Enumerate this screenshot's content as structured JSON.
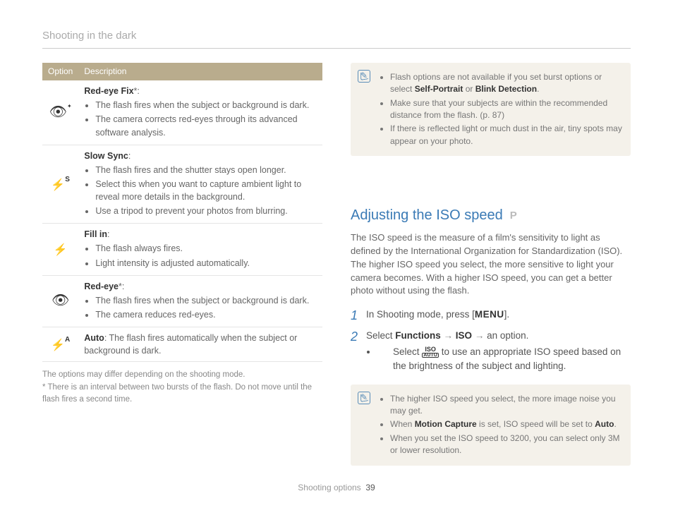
{
  "header": {
    "title": "Shooting in the dark"
  },
  "table": {
    "col_option": "Option",
    "col_description": "Description",
    "rows": [
      {
        "icon_name": "red-eye-fix-icon",
        "title": "Red-eye Fix",
        "title_suffix": "*",
        "title_after": ":",
        "bullets": [
          "The flash fires when the subject or background is dark.",
          "The camera corrects red-eyes through its advanced software analysis."
        ]
      },
      {
        "icon_name": "slow-sync-icon",
        "title": "Slow Sync",
        "title_after": ":",
        "bullets": [
          "The flash fires and the shutter stays open longer.",
          "Select this when you want to capture ambient light to reveal more details in the background.",
          "Use a tripod to prevent your photos from blurring."
        ]
      },
      {
        "icon_name": "fill-in-icon",
        "title": "Fill in",
        "title_after": ":",
        "bullets": [
          "The flash always fires.",
          "Light intensity is adjusted automatically."
        ]
      },
      {
        "icon_name": "red-eye-icon",
        "title": "Red-eye",
        "title_suffix": "*",
        "title_after": ":",
        "bullets": [
          "The flash fires when the subject or background is dark.",
          "The camera reduces red-eyes."
        ]
      },
      {
        "icon_name": "auto-flash-icon",
        "title": "Auto",
        "inline_text": ": The flash fires automatically when the subject or background is dark."
      }
    ]
  },
  "footnotes": {
    "line1": "The options may differ depending on the shooting mode.",
    "line2": "* There is an interval between two bursts of the flash. Do not move until the flash fires a second time."
  },
  "infobox1": {
    "b1_pre": "Flash options are not available if you set burst options or select ",
    "b1_strong1": "Self-Portrait",
    "b1_mid": " or ",
    "b1_strong2": "Blink Detection",
    "b1_post": ".",
    "b2": "Make sure that your subjects are within the recommended distance from the flash. (p. 87)",
    "b3": "If there is reflected light or much dust in the air, tiny spots may appear on your photo."
  },
  "section": {
    "heading": "Adjusting the ISO speed",
    "mode": "P",
    "intro": "The ISO speed is the measure of a film's sensitivity to light as defined by the International Organization for Standardization (ISO). The higher ISO speed you select, the more sensitive to light your camera becomes. With a higher ISO speed, you can get a better photo without using the flash.",
    "step1_pre": "In Shooting mode, press [",
    "step1_menu": "MENU",
    "step1_post": "].",
    "step2_pre": "Select ",
    "step2_functions": "Functions",
    "step2_arrow": " → ",
    "step2_iso": "ISO",
    "step2_post": " an option.",
    "step2_sub_pre": "Select ",
    "step2_sub_post": " to use an appropriate ISO speed based on the brightness of the subject and lighting.",
    "iso_icon_top": "ISO",
    "iso_icon_bottom": "AUTO"
  },
  "infobox2": {
    "b1": "The higher ISO speed you select, the more image noise you may get.",
    "b2_pre": "When ",
    "b2_strong": "Motion Capture",
    "b2_mid": " is set, ISO speed will be set to ",
    "b2_strong2": "Auto",
    "b2_post": ".",
    "b3": "When you set the ISO speed to 3200, you can select only 3M or lower resolution."
  },
  "footer": {
    "section": "Shooting options",
    "page": "39"
  }
}
